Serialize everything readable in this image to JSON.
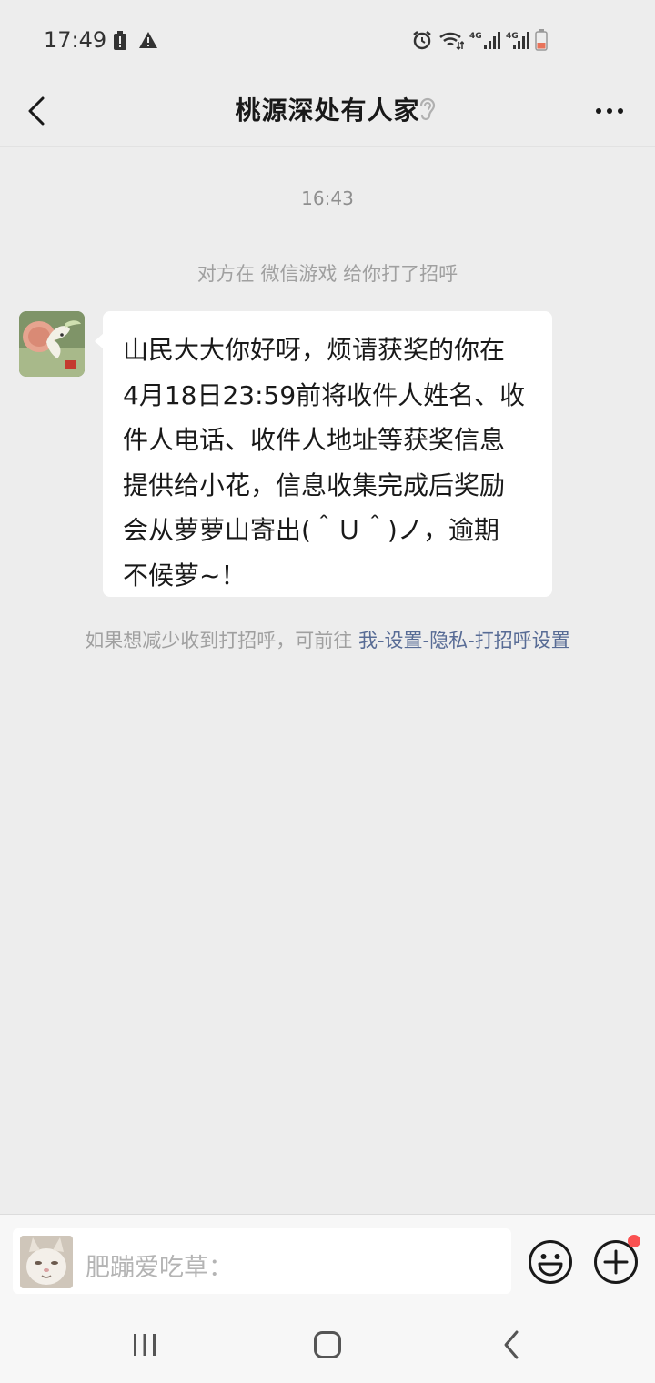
{
  "status_bar": {
    "time": "17:49",
    "left_icons": [
      "battery-alert-icon",
      "warning-icon"
    ],
    "right_icons": [
      "alarm-icon",
      "wifi-icon",
      "signal-4g-icon",
      "signal-4g-icon",
      "battery-icon"
    ]
  },
  "header": {
    "title": "桃源深处有人家",
    "back_icon": "chevron-left-icon",
    "ear_icon": "ear-icon",
    "more_icon": "more-icon"
  },
  "messages": {
    "timestamp": "16:43",
    "system_note": "对方在 微信游戏 给你打了招呼",
    "incoming": {
      "lines": [
        "山民大大你好呀，烦请获奖的你在",
        "4月18日23:59前将收件人姓名、收",
        "件人电话、收件人地址等获奖信息",
        "提供给小花，信息收集完成后奖励",
        "会从萝萝山寄出(＾Ｕ＾)ノ，逾期",
        "不候萝~！"
      ]
    },
    "privacy_tip_prefix": "如果想减少收到打招呼，可前往 ",
    "privacy_tip_link": "我-设置-隐私-打招呼设置"
  },
  "input_bar": {
    "placeholder": "肥蹦爱吃草：",
    "emoji_icon": "emoji-icon",
    "plus_icon": "plus-icon"
  },
  "system_nav": {
    "icons": [
      "recent-apps-icon",
      "home-icon",
      "back-icon"
    ]
  },
  "colors": {
    "background": "#ededed",
    "bubble": "#ffffff",
    "link": "#576b95",
    "notify": "#fa5151"
  }
}
